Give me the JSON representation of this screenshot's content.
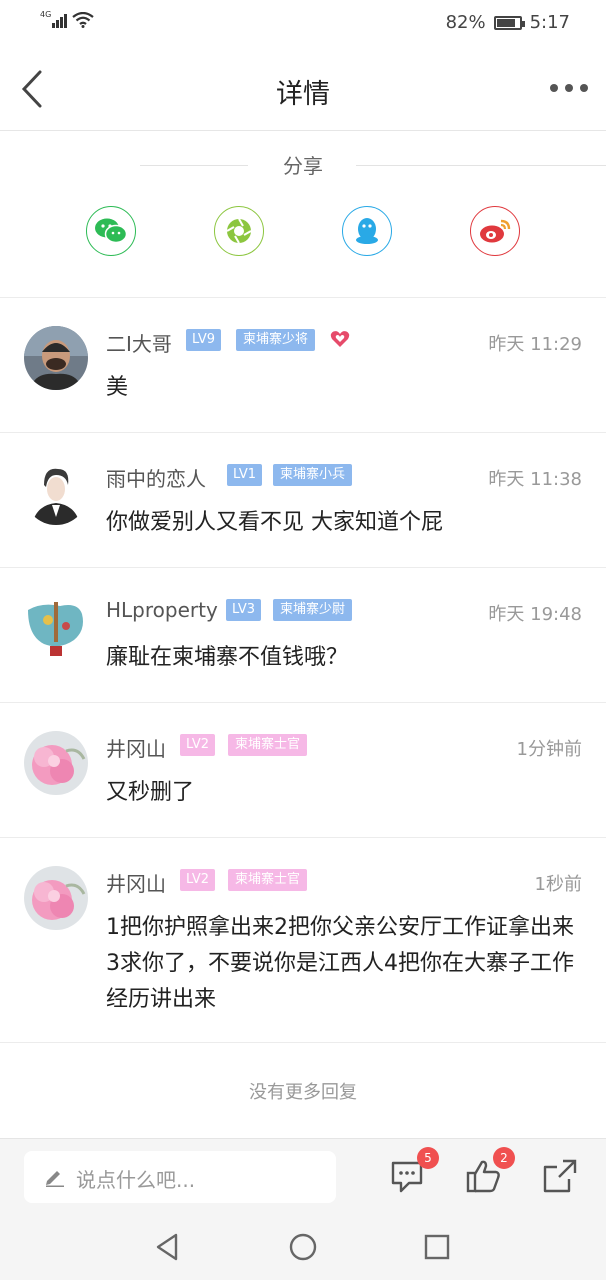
{
  "status_bar": {
    "network": "4G",
    "battery_percent": "82%",
    "battery_level": 0.82,
    "time": "5:17"
  },
  "navbar": {
    "title": "详情"
  },
  "share": {
    "title": "分享",
    "targets": [
      "wechat-icon",
      "moments-icon",
      "qq-icon",
      "weibo-icon"
    ]
  },
  "comments": [
    {
      "name": "二I大哥",
      "level": "LV9",
      "rank": "柬埔寨少将",
      "time": "昨天 11:29",
      "text": "美"
    },
    {
      "name": "雨中的恋人",
      "level": "LV1",
      "rank": "柬埔寨小兵",
      "time": "昨天 11:38",
      "text": "你做爱别人又看不见  大家知道个屁"
    },
    {
      "name": "HLproperty",
      "level": "LV3",
      "rank": "柬埔寨少尉",
      "time": "昨天 19:48",
      "text": "廉耻在柬埔寨不值钱哦？"
    },
    {
      "name": "井冈山",
      "level": "LV2",
      "rank": "柬埔寨士官",
      "time": "1分钟前",
      "text": "又秒删了"
    },
    {
      "name": "井冈山",
      "level": "LV2",
      "rank": "柬埔寨士官",
      "time": "1秒前",
      "text": "1把你护照拿出来2把你父亲公安厅工作证拿出来3求你了，不要说你是江西人4把你在大寨子工作经历讲出来"
    }
  ],
  "no_more": "没有更多回复",
  "bottom_bar": {
    "input_placeholder": "说点什么吧...",
    "comment_count": "5",
    "like_count": "2"
  },
  "colors": {
    "level_blue": "#8db8ee",
    "level_pink": "#f6b8e6",
    "badge_red": "#f05050",
    "wechat_green": "#2dbb55",
    "moments_green": "#8cc63f",
    "qq_blue": "#29a9e6",
    "weibo_red": "#e0393e"
  }
}
